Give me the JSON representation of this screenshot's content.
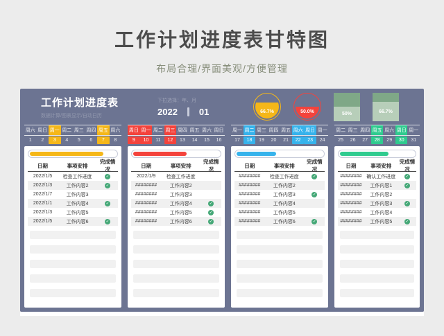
{
  "page": {
    "title": "工作计划进度表甘特图",
    "subtitle": "布局合理/界面美观/方便管理"
  },
  "panel": {
    "title": "工作计划进度表",
    "subtitle": "数据计算/图表显示/自动日历",
    "selector_hint": "下拉选择：年、月",
    "year": "2022",
    "month": "01",
    "background_color": "#6C7492"
  },
  "icons": {
    "check": "✓"
  },
  "colors": {
    "check_green": "#45A877",
    "gauge_square_base": "#7FA887",
    "gauge_square_fill": "#B7CEB9"
  },
  "gauges": [
    {
      "shape": "circle",
      "label": "66.7%",
      "percent": 66.7,
      "color": "#F5B719"
    },
    {
      "shape": "circle",
      "label": "50.0%",
      "percent": 50.0,
      "color": "#F4433C"
    },
    {
      "shape": "square",
      "label": "50%",
      "percent": 50.0,
      "color": "#B7CEB9",
      "base_color": "#7FA887"
    },
    {
      "shape": "square",
      "label": "66.7%",
      "percent": 66.7,
      "color": "#B7CEB9",
      "base_color": "#7FA887"
    }
  ],
  "table_headers": [
    "日期",
    "事项安排",
    "完成情况"
  ],
  "empty_rows_per_column": 5,
  "columns": [
    {
      "accent": "#F5B719",
      "bar_percent": 85,
      "days": [
        {
          "day": "周六",
          "date": "1",
          "highlight": false
        },
        {
          "day": "周日",
          "date": "2",
          "highlight": false
        },
        {
          "day": "周一",
          "date": "3",
          "highlight": true
        },
        {
          "day": "周二",
          "date": "4",
          "highlight": false
        },
        {
          "day": "周三",
          "date": "5",
          "highlight": false
        },
        {
          "day": "周四",
          "date": "6",
          "highlight": false
        },
        {
          "day": "周五",
          "date": "7",
          "highlight": true
        },
        {
          "day": "周六",
          "date": "8",
          "highlight": false
        }
      ],
      "rows": [
        {
          "date": "2022/1/5",
          "task": "检查工作进度",
          "done": true
        },
        {
          "date": "2022/1/3",
          "task": "工作内容2",
          "done": true
        },
        {
          "date": "2022/1/7",
          "task": "工作内容3",
          "done": false
        },
        {
          "date": "2022/1/1",
          "task": "工作内容4",
          "done": true
        },
        {
          "date": "2022/1/3",
          "task": "工作内容5",
          "done": false
        },
        {
          "date": "2022/1/5",
          "task": "工作内容6",
          "done": true
        }
      ]
    },
    {
      "accent": "#F4433C",
      "bar_percent": 62,
      "days": [
        {
          "day": "周日",
          "date": "9",
          "highlight": true
        },
        {
          "day": "周一",
          "date": "10",
          "highlight": true
        },
        {
          "day": "周二",
          "date": "11",
          "highlight": false
        },
        {
          "day": "周三",
          "date": "12",
          "highlight": true
        },
        {
          "day": "周四",
          "date": "13",
          "highlight": false
        },
        {
          "day": "周五",
          "date": "14",
          "highlight": false
        },
        {
          "day": "周六",
          "date": "15",
          "highlight": false
        },
        {
          "day": "周日",
          "date": "16",
          "highlight": false
        }
      ],
      "rows": [
        {
          "date": "2022/1/9",
          "task": "检查工作进度",
          "done": false
        },
        {
          "date": "########",
          "task": "工作内容2",
          "done": false
        },
        {
          "date": "########",
          "task": "工作内容3",
          "done": false
        },
        {
          "date": "########",
          "task": "工作内容4",
          "done": true
        },
        {
          "date": "########",
          "task": "工作内容5",
          "done": true
        },
        {
          "date": "########",
          "task": "工作内容6",
          "done": true
        }
      ]
    },
    {
      "accent": "#36B3EC",
      "bar_percent": 46,
      "days": [
        {
          "day": "周一",
          "date": "17",
          "highlight": false
        },
        {
          "day": "周二",
          "date": "18",
          "highlight": true
        },
        {
          "day": "周三",
          "date": "19",
          "highlight": false
        },
        {
          "day": "周四",
          "date": "20",
          "highlight": false
        },
        {
          "day": "周五",
          "date": "21",
          "highlight": false
        },
        {
          "day": "周六",
          "date": "22",
          "highlight": true
        },
        {
          "day": "周日",
          "date": "23",
          "highlight": true
        },
        {
          "day": "周一",
          "date": "24",
          "highlight": false
        }
      ],
      "rows": [
        {
          "date": "########",
          "task": "检查工作进度",
          "done": true
        },
        {
          "date": "########",
          "task": "工作内容2",
          "done": false
        },
        {
          "date": "########",
          "task": "工作内容3",
          "done": true
        },
        {
          "date": "########",
          "task": "工作内容4",
          "done": false
        },
        {
          "date": "########",
          "task": "工作内容5",
          "done": false
        },
        {
          "date": "########",
          "task": "工作内容6",
          "done": true
        }
      ]
    },
    {
      "accent": "#2FCB8F",
      "bar_percent": 65,
      "days": [
        {
          "day": "周二",
          "date": "25",
          "highlight": false
        },
        {
          "day": "周三",
          "date": "26",
          "highlight": false
        },
        {
          "day": "周四",
          "date": "27",
          "highlight": false
        },
        {
          "day": "周五",
          "date": "28",
          "highlight": true
        },
        {
          "day": "周六",
          "date": "29",
          "highlight": false
        },
        {
          "day": "周日",
          "date": "30",
          "highlight": true
        },
        {
          "day": "周一",
          "date": "31",
          "highlight": false
        }
      ],
      "rows": [
        {
          "date": "########",
          "task": "确认工作进度",
          "done": true
        },
        {
          "date": "########",
          "task": "工作内容1",
          "done": true
        },
        {
          "date": "########",
          "task": "工作内容2",
          "done": false
        },
        {
          "date": "########",
          "task": "工作内容3",
          "done": true
        },
        {
          "date": "########",
          "task": "工作内容4",
          "done": false
        },
        {
          "date": "########",
          "task": "工作内容5",
          "done": true
        }
      ]
    }
  ]
}
